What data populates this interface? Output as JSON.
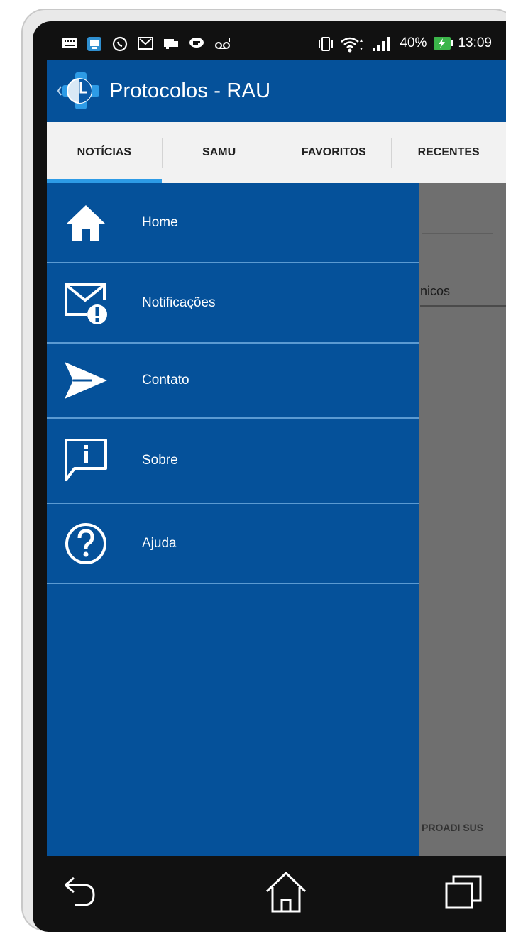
{
  "status_bar": {
    "battery_percent": "40%",
    "time": "13:09",
    "battery_color": "#3bb54a",
    "icons": [
      "keyboard-icon",
      "app-icon",
      "whatsapp-icon",
      "gmail-icon",
      "chat-icon",
      "message-icon",
      "voicemail-icon",
      "vibrate-icon",
      "wifi-icon",
      "signal-icon"
    ]
  },
  "app_bar": {
    "title": "Protocolos - RAU",
    "color": "#05519a",
    "logo": "app-logo-icon"
  },
  "tabs": [
    {
      "label": "NOTÍCIAS",
      "active": true
    },
    {
      "label": "SAMU",
      "active": false
    },
    {
      "label": "FAVORITOS",
      "active": false
    },
    {
      "label": "RECENTES",
      "active": false
    }
  ],
  "drawer": {
    "items": [
      {
        "label": "Home",
        "icon": "home-icon"
      },
      {
        "label": "Notificações",
        "icon": "mail-alert-icon"
      },
      {
        "label": "Contato",
        "icon": "send-icon"
      },
      {
        "label": "Sobre",
        "icon": "info-icon"
      },
      {
        "label": "Ajuda",
        "icon": "help-icon"
      }
    ]
  },
  "background": {
    "partial_text": "nicos",
    "footer_text": "PROADI SUS"
  },
  "nav_bar": {
    "icons": [
      "back-icon",
      "home-nav-icon",
      "recents-icon"
    ]
  }
}
